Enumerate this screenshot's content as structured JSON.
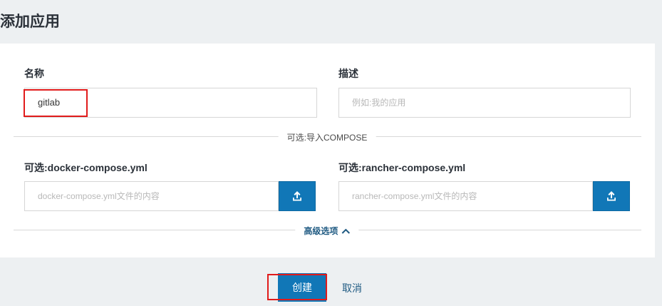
{
  "page": {
    "title": "添加应用"
  },
  "form": {
    "name": {
      "label": "名称",
      "value": "gitlab"
    },
    "description": {
      "label": "描述",
      "placeholder": "例如:我的应用"
    },
    "import_divider": "可选:导入COMPOSE",
    "docker_compose": {
      "label": "可选:docker-compose.yml",
      "placeholder": "docker-compose.yml文件的内容"
    },
    "rancher_compose": {
      "label": "可选:rancher-compose.yml",
      "placeholder": "rancher-compose.yml文件的内容"
    },
    "advanced_toggle": "高级选项"
  },
  "actions": {
    "create_label": "创建",
    "cancel_label": "取消"
  },
  "colors": {
    "accent": "#1177b7",
    "highlight": "#e11b1b",
    "link": "#1f5a82"
  },
  "icons": {
    "upload": "upload-icon",
    "chevron": "chevron-up-icon"
  }
}
